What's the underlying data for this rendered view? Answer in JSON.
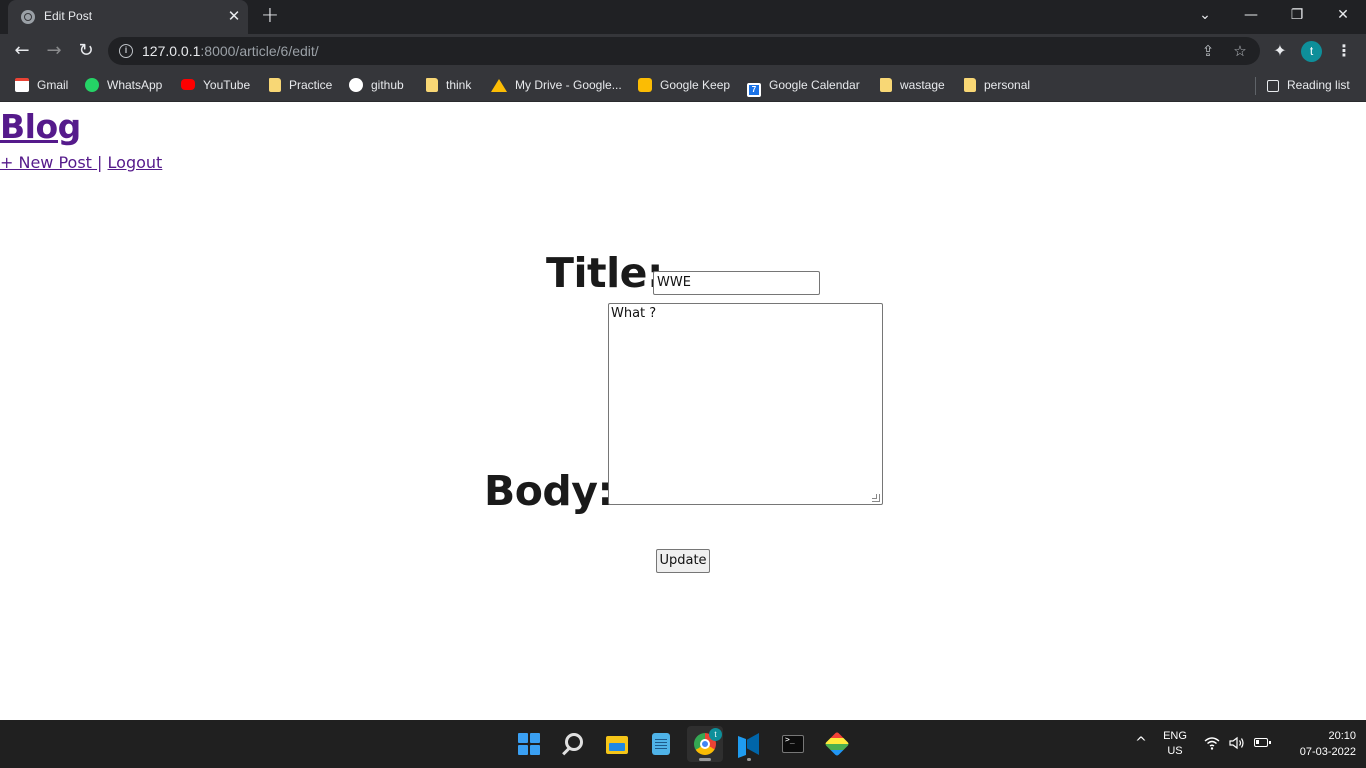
{
  "browser": {
    "tab": {
      "title": "Edit Post",
      "close_label": "✕",
      "favicon": "globe-icon"
    },
    "new_tab_label": "+",
    "window_controls": {
      "tab_search": "⌄",
      "minimize": "—",
      "maximize": "❐",
      "close": "✕"
    },
    "nav": {
      "back": "←",
      "forward": "→",
      "reload": "↻"
    },
    "address": {
      "host": "127.0.0.1",
      "path": ":8000/article/6/edit/",
      "info": "i"
    },
    "omni_icons": {
      "share": "⇪",
      "star": "☆"
    },
    "extensions": "✦",
    "profile_initial": "t",
    "menu": "⋮",
    "bookmarks": [
      {
        "label": "Gmail",
        "icon": "gmail-icon"
      },
      {
        "label": "WhatsApp",
        "icon": "whatsapp-icon"
      },
      {
        "label": "YouTube",
        "icon": "youtube-icon"
      },
      {
        "label": "Practice",
        "icon": "folder-icon"
      },
      {
        "label": "github",
        "icon": "github-icon"
      },
      {
        "label": "think",
        "icon": "folder-icon"
      },
      {
        "label": "My Drive - Google...",
        "icon": "drive-icon"
      },
      {
        "label": "Google Keep",
        "icon": "keep-icon"
      },
      {
        "label": "Google Calendar",
        "icon": "calendar-icon",
        "badge": "7"
      },
      {
        "label": "wastage",
        "icon": "folder-icon"
      },
      {
        "label": "personal",
        "icon": "folder-icon"
      }
    ],
    "reading_list": "Reading list"
  },
  "page": {
    "brand": "Blog",
    "nav": {
      "new_post": "+ New Post ",
      "separator": "|",
      "logout": "Logout"
    },
    "form": {
      "title_label": "Title:",
      "title_value": "WWE",
      "body_label": "Body:",
      "body_value": "What ?",
      "submit_label": "Update"
    }
  },
  "taskbar": {
    "apps": [
      {
        "name": "start",
        "icon": "windows-start-icon",
        "active": false
      },
      {
        "name": "search",
        "icon": "search-icon",
        "active": false
      },
      {
        "name": "file-explorer",
        "icon": "folder-icon",
        "active": false
      },
      {
        "name": "notepad",
        "icon": "notepad-icon",
        "active": false
      },
      {
        "name": "chrome",
        "icon": "chrome-icon",
        "active": true,
        "badge": "t"
      },
      {
        "name": "vscode",
        "icon": "vscode-icon",
        "active": false
      },
      {
        "name": "terminal",
        "icon": "terminal-icon",
        "active": false
      },
      {
        "name": "bluestacks",
        "icon": "bluestacks-icon",
        "active": false
      }
    ],
    "tray": {
      "chevron": "^",
      "lang_line1": "ENG",
      "lang_line2": "US",
      "time": "20:10",
      "date": "07-03-2022"
    }
  }
}
